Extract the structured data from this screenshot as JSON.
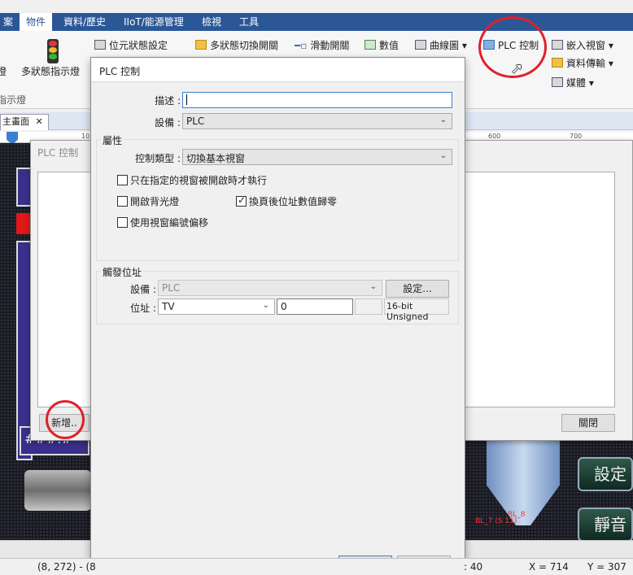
{
  "ribbon": {
    "tabs": [
      "案",
      "物件",
      "資料/歷史",
      "IIoT/能源管理",
      "檢視",
      "工具"
    ],
    "items": {
      "bit_state": "位元狀態設定",
      "multi_switch": "多狀態切換開關",
      "slide_switch": "滑動開關",
      "numeric": "數值",
      "trend": "曲線圖",
      "plc_control": "PLC 控制",
      "embed_window": "嵌入視窗",
      "data_transfer": "資料傳輸",
      "media": "媒體",
      "lamp": "燈",
      "multi_lamp": "多狀態指示燈",
      "lamp_group": "指示燈"
    }
  },
  "doc": {
    "tab": "主畫面",
    "ruler_marks": [
      "10",
      "600",
      "700"
    ]
  },
  "bg_dialog": {
    "title": "PLC 控制",
    "add_button": "新增..",
    "close_button": "關閉"
  },
  "dialog": {
    "title": "PLC 控制",
    "desc_label": "描述 :",
    "desc_value": "",
    "device_label": "設備 :",
    "device_value": "PLC",
    "attr_group": "屬性",
    "ctrl_type_label": "控制類型 :",
    "ctrl_type_value": "切換基本視窗",
    "chk_only_window": "只在指定的視窗被開啟時才執行",
    "chk_backlight": "開啟背光燈",
    "chk_reset": "換頁後位址數值歸零",
    "chk_offset": "使用視窗編號偏移",
    "trigger_group": "觸發位址",
    "t_device_label": "設備 :",
    "t_device_value": "PLC",
    "settings_button": "設定...",
    "addr_label": "位址 :",
    "addr_type": "TV",
    "addr_value": "0",
    "addr_format": "16-bit Unsigned",
    "ok_button": "確定",
    "cancel_button": "取消"
  },
  "canvas": {
    "labels": [
      "#",
      "###.#",
      "設定",
      "靜音",
      "BL_8",
      "BL_7 (S 11)"
    ]
  },
  "status": {
    "left": "(8, 272) - (8",
    "mid": ": 40",
    "x": "X = 714",
    "y": "Y = 307"
  }
}
